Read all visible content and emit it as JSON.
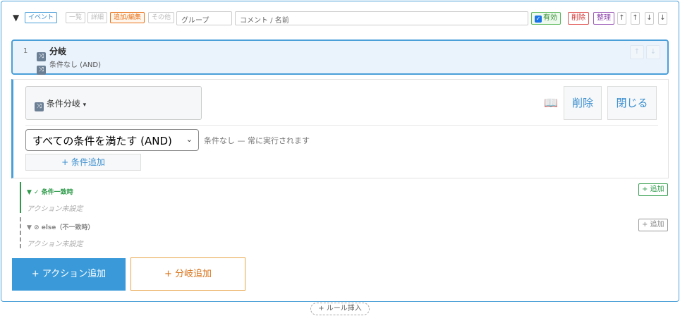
{
  "header": {
    "toggle": "▼",
    "tags": [
      "イベント",
      "一覧",
      "詳細",
      "追加/編集",
      "その他"
    ],
    "group_placeholder": "グループ",
    "comment_placeholder": "コメント / 名前",
    "enabled_label": "有効",
    "enabled_checked": true,
    "delete_label": "削除",
    "tidy_label": "整理",
    "arrows": [
      "↑",
      "↑",
      "↓",
      "↓"
    ]
  },
  "branch": {
    "number": "1",
    "title": "分岐",
    "subtitle": "条件なし (AND)",
    "move_up": "↑",
    "move_down": "↓"
  },
  "editor": {
    "type_label": "条件分岐",
    "delete_label": "削除",
    "close_label": "閉じる",
    "mode_value": "すべての条件を満たす (AND)",
    "mode_note": "条件なし — 常に実行されます",
    "add_condition_label": "+ 条件追加"
  },
  "branches": {
    "match": {
      "label": "▼ ✓ 条件一致時",
      "empty": "アクション未設定",
      "add_label": "+ 追加",
      "color": "#2e9b4a"
    },
    "else": {
      "label": "▼ ⊘ else（不一致時）",
      "empty": "アクション未設定",
      "add_label": "+ 追加",
      "color": "#888888"
    }
  },
  "footer": {
    "add_action_label": "+ アクション追加",
    "add_branch_label": "+ 分岐追加",
    "insert_rule_label": "+ ルール挿入"
  },
  "icons": {
    "branch": "shuffle-icon",
    "docs": "book-icon"
  }
}
